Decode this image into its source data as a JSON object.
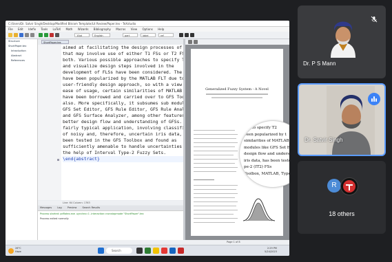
{
  "texstudio": {
    "title": "C:/Users/Dr. Satvir Singh/Desktop/Modified Bikram Template/Lit Review/Paper.tex - TeXstudio",
    "menu": [
      "File",
      "Edit",
      "Idefix",
      "Tools",
      "LaTeX",
      "Math",
      "Wizards",
      "Bibliography",
      "Macros",
      "View",
      "Options",
      "Help"
    ],
    "toolbar": {
      "font_size": "10pt",
      "font": "English",
      "style": "part",
      "label": "label",
      "ref": "ref"
    },
    "editor_tab": "ShortPaper.tex",
    "sidebar": [
      "Structure",
      "ShortPaper.tex",
      "Introduction",
      "Abstract",
      "References"
    ],
    "code_lines": [
      "aimed at facilitating the design processes of FLSs",
      "that may involve use of either T1 FSs or T2 FSs or",
      "both. Various possible approaches to specify T2 FSs",
      "and visualize design steps involved in the",
      "development of FLSs have been considered. The FLSs",
      "have been popularized by the MATLAB FLT due to its",
      "user-friendly design approach, so with a view to lend",
      "ease of usage, certain similarities of MATLAB FLT",
      "have been borrowed and carried over to GFS Toolbox",
      "also. More specifically, it subsumes sub modules like",
      "GFS Set Editor, GFS Rule Editor, GFS Rule Analyzer",
      "and GFS Surface Analyzer, among other features, for",
      "better design flow and understanding of GFSs. A",
      "fairly typical application, involving classification",
      "of noisy and, therefore, uncertain iris data, has",
      "been tested in the GFS Toolbox and found as",
      "sufficiently amenable to handle uncertainties with",
      "the help of Interval Type-2 Fuzzy Sets.",
      "\\end{abstract}"
    ],
    "messages_tabs": [
      "Messages",
      "Log",
      "Preview",
      "Search Results"
    ],
    "message_ok": "Process exited normally",
    "message_line": "Process started: pdflatex.exe -synctex=1 -interaction=nonstopmode \"ShortPaper\".tex",
    "pdf": {
      "paper_title": "Generalized Fuzzy System - A Novel",
      "magnifier_lines": [
        "ans to specify T2",
        "been popularized by t",
        "similarities of MATLAB FLT h",
        "modules like GFS Set Editor, GFS",
        "design flow and understanding of",
        "iris data, has been tested in the GFS",
        "pe-2 (IT2) FSs",
        "Toolbox, MATLAB, Type-2 Fu"
      ],
      "page_status": "Page 1 of 8"
    },
    "editor_status": "Line: 64  Column: 1763",
    "taskbar": {
      "weather_temp": "26°C",
      "weather_desc": "Haze",
      "search": "Search",
      "time": "2:29 PM",
      "date": "5/24/2023"
    }
  },
  "participants": [
    {
      "name": "Dr. P S Mann",
      "muted": true
    },
    {
      "name": "Dr. Satvir Singh",
      "speaking": true
    },
    {
      "name": "18 others",
      "avatar_letter": "R"
    }
  ],
  "colors": {
    "speaking_blue": "#3b82f6",
    "avatar_blue": "#4c8bd6",
    "highlight_border": "#5b9cff"
  }
}
